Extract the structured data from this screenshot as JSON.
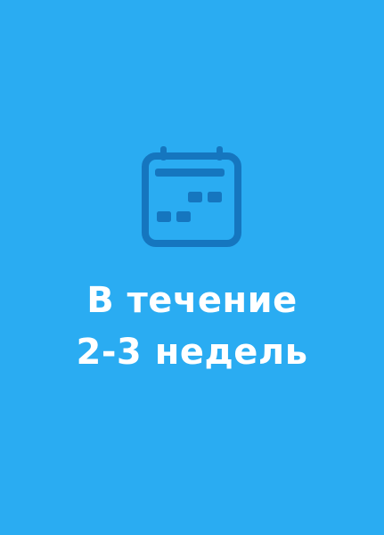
{
  "card": {
    "background_color": "#2aacf2",
    "icon": "calendar-icon",
    "icon_color": "#1576bf",
    "headline": {
      "line1": "В течение",
      "line2": "2-3 недель"
    }
  }
}
